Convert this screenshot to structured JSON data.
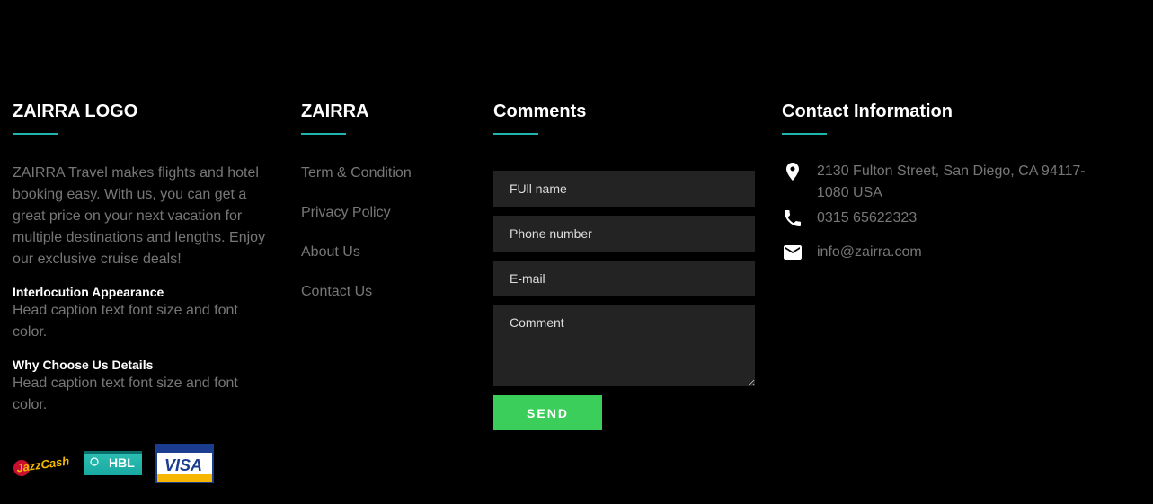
{
  "about": {
    "title": "ZAIRRA LOGO",
    "text": "ZAIRRA Travel makes flights and hotel booking easy. With us, you can get a great price on your next vacation for multiple destinations and lengths. Enjoy our exclusive cruise deals!",
    "sub1_title": "Interlocution Appearance",
    "sub1_text": "Head caption text font size and font color.",
    "sub2_title": "Why Choose Us Details",
    "sub2_text": "Head caption text font size and font color."
  },
  "links": {
    "title": "ZAIRRA",
    "items": [
      "Term & Condition",
      "Privacy Policy",
      "About Us",
      "Contact Us"
    ]
  },
  "comments": {
    "title": "Comments",
    "name_placeholder": "FUll name",
    "phone_placeholder": "Phone number",
    "email_placeholder": "E-mail",
    "comment_placeholder": "Comment",
    "send_label": "SEND"
  },
  "contact": {
    "title": "Contact Information",
    "address": "2130 Fulton Street, San Diego, CA 94117-1080 USA",
    "phone": "0315 65622323",
    "email": "info@zairra.com"
  },
  "payments": {
    "jazzcash": "JazzCash",
    "hbl": "HBL",
    "visa": "VISA"
  },
  "colors": {
    "accent": "#1fb5ad",
    "send_button": "#3cce5b",
    "muted_text": "#777777",
    "field_bg": "#232323"
  }
}
